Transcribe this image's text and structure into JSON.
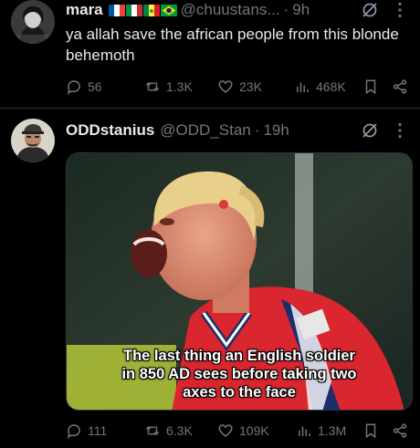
{
  "post1": {
    "name": "mara",
    "handle": "@chuustans...",
    "time": "9h",
    "text": "ya allah save the african people from this blonde behemoth",
    "flags": [
      "france-flag",
      "italy-flag",
      "senegal-flag",
      "brazil-flag"
    ],
    "stats": {
      "replies": "56",
      "reposts": "1.3K",
      "likes": "23K",
      "views": "468K"
    }
  },
  "post2": {
    "name": "ODDstanius",
    "handle": "@ODD_Stan",
    "time": "19h",
    "caption_lines": [
      "The last thing an English soldier",
      "in 850 AD sees before taking two",
      "axes to the face"
    ],
    "stats": {
      "replies": "111",
      "reposts": "6.3K",
      "likes": "109K",
      "views": "1.3M"
    }
  },
  "separator": "·",
  "colors": {
    "background": "#000000",
    "text": "#e7e9ea",
    "muted": "#71767b",
    "divider": "#2f3336"
  }
}
